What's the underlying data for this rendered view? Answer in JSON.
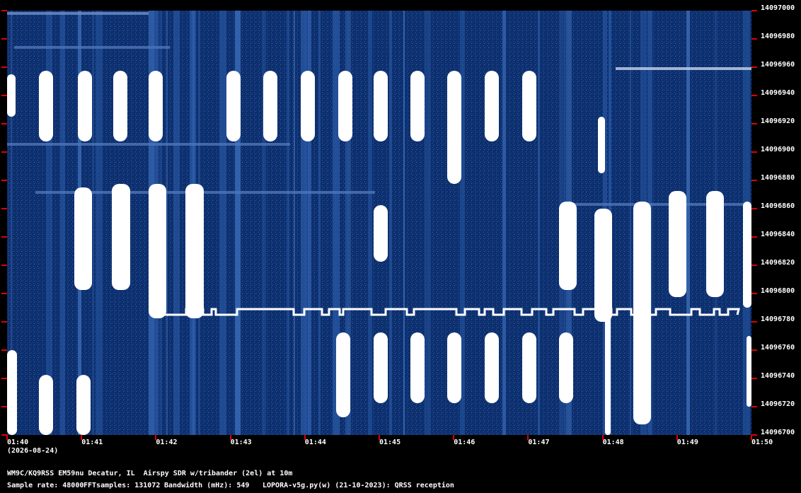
{
  "spectrogram": {
    "y_labels": [
      "14097000",
      "14096980",
      "14096960",
      "14096940",
      "14096920",
      "14096900",
      "14096880",
      "14096860",
      "14096840",
      "14096820",
      "14096800",
      "14096780",
      "14096760",
      "14096740",
      "14096720",
      "14096700"
    ],
    "x_labels": [
      "01:40",
      "01:41",
      "01:42",
      "01:43",
      "01:44",
      "01:45",
      "01:46",
      "01:47",
      "01:48",
      "01:49",
      "01:50"
    ],
    "date_label": "(2026-08-24)",
    "colors": {
      "background": "#0d2f6e",
      "signal": "#ffffff",
      "tick_marks": "#e00000"
    }
  },
  "footer": {
    "station": "WM9C/KQ9RSS EM59nu Decatur, IL  Airspy SDR w/tribander (2el) at 10m",
    "sample_rate": "Sample rate: 48000",
    "fft_samples": "FFTsamples: 131072",
    "bandwidth": "Bandwidth (mHz): 549",
    "software": "LOPORA-v5g.py(w) (21-10-2023): QRSS reception"
  }
}
